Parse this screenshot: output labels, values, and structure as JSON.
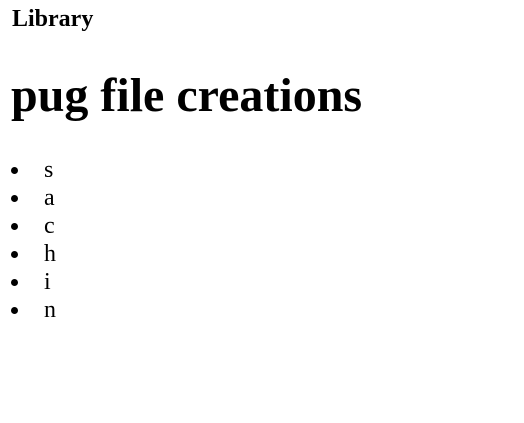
{
  "header": {
    "title": "Library"
  },
  "main": {
    "heading": "pug file creations",
    "items": [
      "s",
      "a",
      "c",
      "h",
      "i",
      "n"
    ]
  }
}
